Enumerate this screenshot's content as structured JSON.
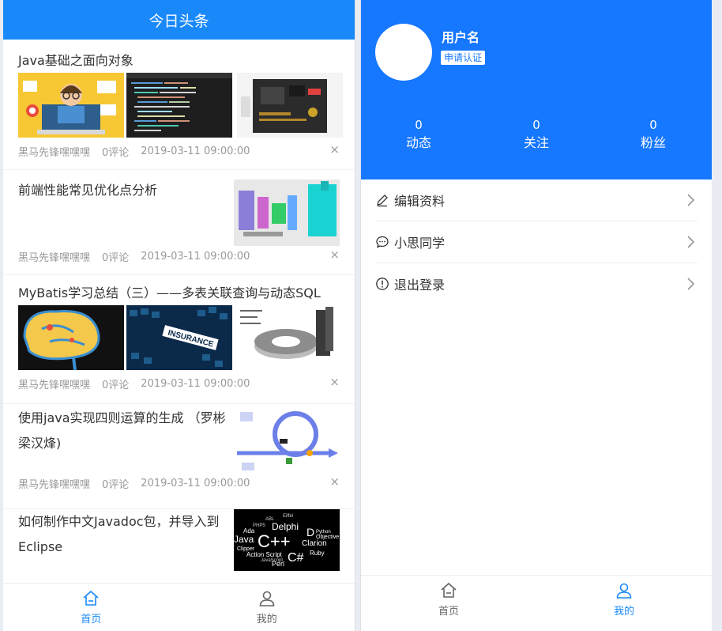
{
  "left_screen": {
    "nav_title": "今日头条",
    "articles": [
      {
        "title": "Java基础之面向对象",
        "author": "黑马先锋嘿嘿嘿",
        "comments": "0评论",
        "date": "2019-03-11 09:00:00"
      },
      {
        "title": "前端性能常见优化点分析",
        "author": "黑马先锋嘿嘿嘿",
        "comments": "0评论",
        "date": "2019-03-11 09:00:00"
      },
      {
        "title": "MyBatis学习总结（三）——多表关联查询与动态SQL",
        "author": "黑马先锋嘿嘿嘿",
        "comments": "0评论",
        "date": "2019-03-11 09:00:00"
      },
      {
        "title_line1": "使用java实现四则运算的生成 （罗彬",
        "title_line2": "梁汉烽)",
        "author": "黑马先锋嘿嘿嘿",
        "comments": "0评论",
        "date": "2019-03-11 09:00:00"
      },
      {
        "title_line1": "如何制作中文Javadoc包，并导入到",
        "title_line2": "Eclipse"
      }
    ],
    "close_glyph": "×",
    "tabbar": {
      "home": "首页",
      "mine": "我的"
    },
    "thumb_text": {
      "insurance": "INSURANCE",
      "cloud_big": [
        "C++",
        "Java",
        "Delphi",
        "C#",
        "D",
        "Clarion",
        "Ada",
        "Perl",
        "Ruby",
        "Python",
        "Objective",
        "Action Script",
        "JavaScript",
        "Clipper",
        "PHP5",
        "Eiffel",
        "ABL"
      ]
    }
  },
  "right_screen": {
    "username": "用户名",
    "certify_button": "申请认证",
    "stats": [
      {
        "value": "0",
        "label": "动态"
      },
      {
        "value": "0",
        "label": "关注"
      },
      {
        "value": "0",
        "label": "粉丝"
      }
    ],
    "menu": [
      {
        "label": "编辑资料",
        "icon": "edit-icon"
      },
      {
        "label": "小思同学",
        "icon": "chat-icon"
      },
      {
        "label": "退出登录",
        "icon": "info-icon"
      }
    ],
    "tabbar": {
      "home": "首页",
      "mine": "我的"
    }
  },
  "colors": {
    "brand_blue": "#1989fa",
    "profile_blue": "#1677ff",
    "meta_gray": "#999999"
  }
}
